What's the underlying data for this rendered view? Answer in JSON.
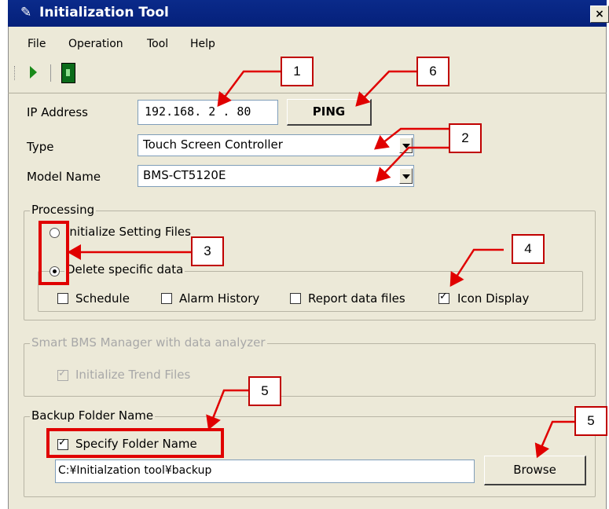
{
  "window": {
    "title": "Initialization Tool",
    "close_glyph": "×"
  },
  "menu": [
    {
      "label": "File",
      "accel": "F"
    },
    {
      "label": "Operation",
      "accel": ""
    },
    {
      "label": "Tool",
      "accel": "T"
    },
    {
      "label": "Help",
      "accel": "H"
    }
  ],
  "toolbar": {
    "icons": [
      "play-icon",
      "exit-icon"
    ]
  },
  "form": {
    "ip_label": "IP Address",
    "ip_value": "192.168. 2 . 80",
    "ping_label": "PING",
    "type_label": "Type",
    "type_value": "Touch Screen Controller",
    "model_label": "Model Name",
    "model_value": "BMS-CT5120E"
  },
  "processing": {
    "title": "Processing",
    "opt_initialize": "Initialize Setting Files",
    "opt_delete": "Delete specific data",
    "selected": "Delete specific data",
    "checks": [
      {
        "label": "Schedule",
        "checked": false
      },
      {
        "label": "Alarm History",
        "checked": false
      },
      {
        "label": "Report data files",
        "checked": false
      },
      {
        "label": "Icon Display",
        "checked": true
      }
    ]
  },
  "smart": {
    "title": "Smart BMS Manager with data analyzer",
    "trend_label": "Initialize Trend Files",
    "trend_checked": true,
    "enabled": false
  },
  "backup": {
    "title": "Backup Folder Name",
    "specify_label": "Specify Folder Name",
    "specify_checked": true,
    "path_value": "C:¥Initialzation tool¥backup",
    "browse_label": "Browse"
  },
  "annotations": {
    "c1": "1",
    "c2": "2",
    "c3": "3",
    "c4": "4",
    "c5a": "5",
    "c5b": "5",
    "c6": "6",
    "color": "#e00000"
  }
}
